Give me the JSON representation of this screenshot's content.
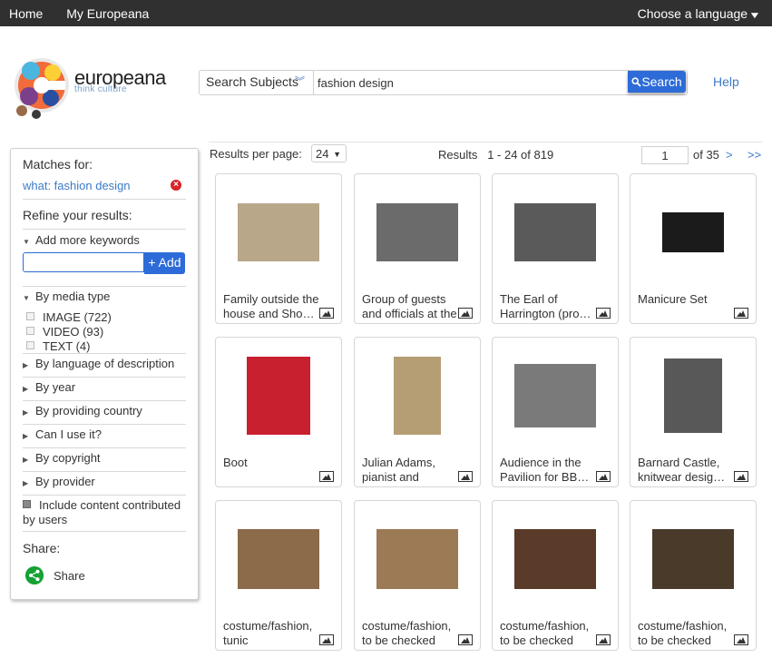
{
  "topbar": {
    "home": "Home",
    "my_europeana": "My Europeana",
    "choose_language": "Choose a language"
  },
  "logo": {
    "word": "europeana",
    "tagline": "think culture"
  },
  "search": {
    "type_label": "Search Subjects",
    "query": "fashion design",
    "button_label": "Search"
  },
  "help": "Help",
  "sidebar": {
    "matches_for": "Matches for:",
    "match": "what: fashion design",
    "refine": "Refine your results:",
    "add_keywords": "Add more keywords",
    "add_button": "+ Add",
    "media_type": "By media type",
    "media_options": [
      {
        "label": "IMAGE (722)"
      },
      {
        "label": "VIDEO (93)"
      },
      {
        "label": "TEXT (4)"
      }
    ],
    "language": "By language of description",
    "year": "By year",
    "country": "By providing country",
    "can_use": "Can I use it?",
    "copyright": "By copyright",
    "provider": "By provider",
    "ugc_line1": "Include content contributed",
    "ugc_line2": "by users",
    "share_title": "Share:",
    "share_label": "Share"
  },
  "results_bar": {
    "per_page_label": "Results per page:",
    "per_page_value": "24",
    "results_label": "Results",
    "results_range": "1 - 24 of 819",
    "page": "1",
    "of_pages": "of 35",
    "next": ">",
    "last": ">>"
  },
  "results": [
    {
      "title": "Family outside the house and Sho…",
      "thumb_color": "#b8a789"
    },
    {
      "title": "Group of guests and officials at the …",
      "thumb_color": "#6b6b6b"
    },
    {
      "title": "The Earl of Harrington (pro…",
      "thumb_color": "#5a5a5a"
    },
    {
      "title": "Manicure Set",
      "thumb_color": "#1b1b1b"
    },
    {
      "title": "Boot",
      "thumb_color": "#c9202f"
    },
    {
      "title": "Julian Adams, pianist and performer, …",
      "thumb_color": "#b59d74"
    },
    {
      "title": "Audience in the Pavilion for BB…",
      "thumb_color": "#7a7a7a"
    },
    {
      "title": "Barnard Castle, knitwear desig…",
      "thumb_color": "#585858"
    },
    {
      "title": "costume/fashion, tunic",
      "thumb_color": "#8b6b4a"
    },
    {
      "title": "costume/fashion, to be checked",
      "thumb_color": "#9c7a55"
    },
    {
      "title": "costume/fashion, to be checked",
      "thumb_color": "#5a3a28"
    },
    {
      "title": "costume/fashion, to be checked",
      "thumb_color": "#4a3a2a"
    }
  ]
}
